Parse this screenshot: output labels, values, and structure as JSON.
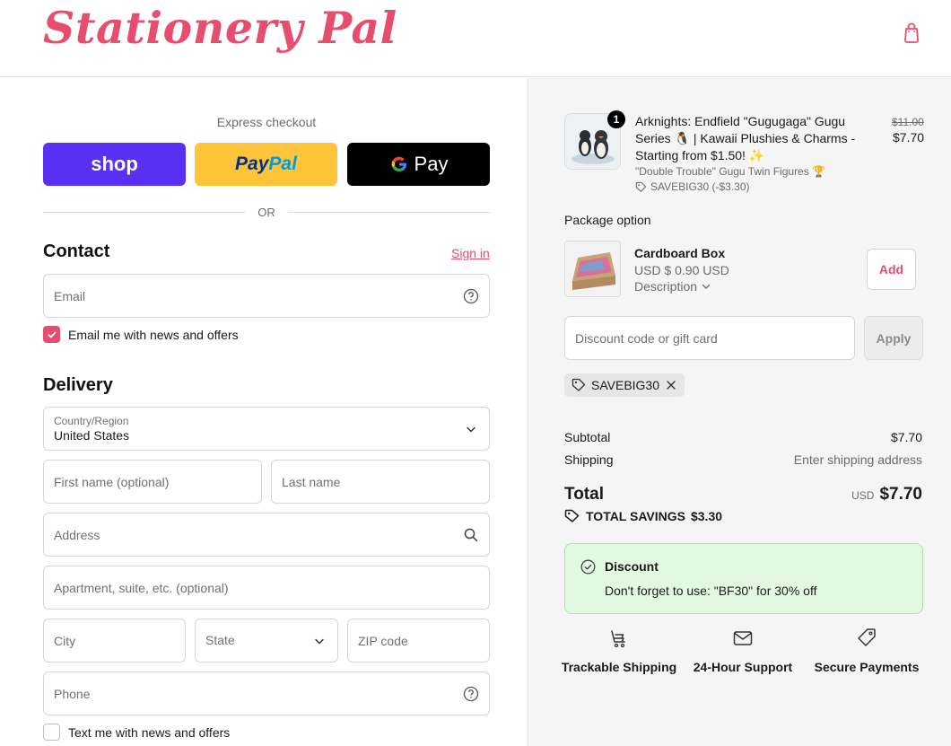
{
  "brand": {
    "name": "Stationery Pal",
    "accent": "#e64d6f"
  },
  "header": {
    "cart_icon": "shopping-bag-icon"
  },
  "express": {
    "label": "Express checkout",
    "shop_label": "shop",
    "paypal_label_1": "Pay",
    "paypal_label_2": "Pal",
    "gpay_label": "Pay",
    "or_text": "OR"
  },
  "contact": {
    "title": "Contact",
    "signin": "Sign in",
    "email_placeholder": "Email",
    "email_news_label": "Email me with news and offers",
    "email_news_checked": true
  },
  "delivery": {
    "title": "Delivery",
    "country_label": "Country/Region",
    "country_value": "United States",
    "first_name_placeholder": "First name (optional)",
    "last_name_placeholder": "Last name",
    "address_placeholder": "Address",
    "apartment_placeholder": "Apartment, suite, etc. (optional)",
    "city_placeholder": "City",
    "state_placeholder": "State",
    "zip_placeholder": "ZIP code",
    "phone_placeholder": "Phone",
    "text_news_label": "Text me with news and offers",
    "text_news_checked": false
  },
  "order": {
    "item": {
      "quantity": "1",
      "title": "Arknights: Endfield \"Gugugaga\" Gugu Series 🐧 | Kawaii Plushies & Charms - Starting from $1.50! ✨",
      "variant": "\"Double Trouble\" Gugu Twin Figures 🏆",
      "discount": "SAVEBIG30 (-$3.30)",
      "price_original": "$11.00",
      "price": "$7.70"
    },
    "package": {
      "label": "Package option",
      "name": "Cardboard Box",
      "price": "USD $ 0.90 USD",
      "description": "Description",
      "add_label": "Add"
    },
    "discount_placeholder": "Discount code or gift card",
    "apply_label": "Apply",
    "applied_code": "SAVEBIG30",
    "subtotal_label": "Subtotal",
    "subtotal_value": "$7.70",
    "shipping_label": "Shipping",
    "shipping_value": "Enter shipping address",
    "total_label": "Total",
    "total_currency": "USD",
    "total_value": "$7.70",
    "savings_label": "TOTAL SAVINGS",
    "savings_value": "$3.30"
  },
  "discount_notice": {
    "title": "Discount",
    "text": "Don't forget to use: \"BF30\" for 30% off"
  },
  "features": [
    {
      "icon": "cart-truck-icon",
      "label": "Trackable Shipping"
    },
    {
      "icon": "mail-icon",
      "label": "24-Hour Support"
    },
    {
      "icon": "tag-icon",
      "label": "Secure Payments"
    }
  ]
}
